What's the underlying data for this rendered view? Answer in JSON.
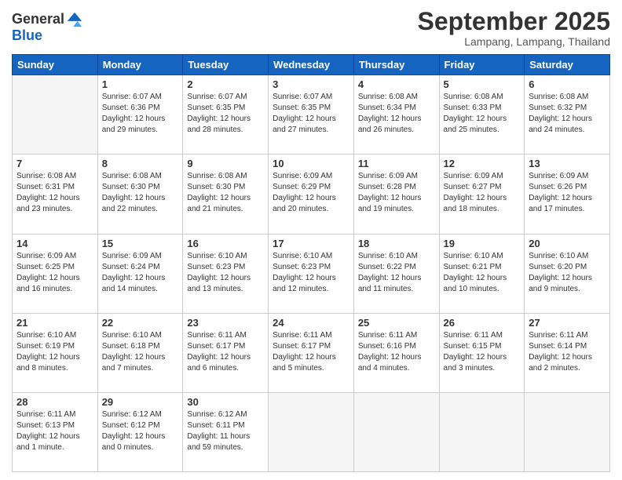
{
  "logo": {
    "general": "General",
    "blue": "Blue"
  },
  "header": {
    "month": "September 2025",
    "location": "Lampang, Lampang, Thailand"
  },
  "weekdays": [
    "Sunday",
    "Monday",
    "Tuesday",
    "Wednesday",
    "Thursday",
    "Friday",
    "Saturday"
  ],
  "weeks": [
    [
      {
        "day": "",
        "empty": true
      },
      {
        "day": "1",
        "sunrise": "6:07 AM",
        "sunset": "6:36 PM",
        "daylight": "12 hours and 29 minutes."
      },
      {
        "day": "2",
        "sunrise": "6:07 AM",
        "sunset": "6:35 PM",
        "daylight": "12 hours and 28 minutes."
      },
      {
        "day": "3",
        "sunrise": "6:07 AM",
        "sunset": "6:35 PM",
        "daylight": "12 hours and 27 minutes."
      },
      {
        "day": "4",
        "sunrise": "6:08 AM",
        "sunset": "6:34 PM",
        "daylight": "12 hours and 26 minutes."
      },
      {
        "day": "5",
        "sunrise": "6:08 AM",
        "sunset": "6:33 PM",
        "daylight": "12 hours and 25 minutes."
      },
      {
        "day": "6",
        "sunrise": "6:08 AM",
        "sunset": "6:32 PM",
        "daylight": "12 hours and 24 minutes."
      }
    ],
    [
      {
        "day": "7",
        "sunrise": "6:08 AM",
        "sunset": "6:31 PM",
        "daylight": "12 hours and 23 minutes."
      },
      {
        "day": "8",
        "sunrise": "6:08 AM",
        "sunset": "6:30 PM",
        "daylight": "12 hours and 22 minutes."
      },
      {
        "day": "9",
        "sunrise": "6:08 AM",
        "sunset": "6:30 PM",
        "daylight": "12 hours and 21 minutes."
      },
      {
        "day": "10",
        "sunrise": "6:09 AM",
        "sunset": "6:29 PM",
        "daylight": "12 hours and 20 minutes."
      },
      {
        "day": "11",
        "sunrise": "6:09 AM",
        "sunset": "6:28 PM",
        "daylight": "12 hours and 19 minutes."
      },
      {
        "day": "12",
        "sunrise": "6:09 AM",
        "sunset": "6:27 PM",
        "daylight": "12 hours and 18 minutes."
      },
      {
        "day": "13",
        "sunrise": "6:09 AM",
        "sunset": "6:26 PM",
        "daylight": "12 hours and 17 minutes."
      }
    ],
    [
      {
        "day": "14",
        "sunrise": "6:09 AM",
        "sunset": "6:25 PM",
        "daylight": "12 hours and 16 minutes."
      },
      {
        "day": "15",
        "sunrise": "6:09 AM",
        "sunset": "6:24 PM",
        "daylight": "12 hours and 14 minutes."
      },
      {
        "day": "16",
        "sunrise": "6:10 AM",
        "sunset": "6:23 PM",
        "daylight": "12 hours and 13 minutes."
      },
      {
        "day": "17",
        "sunrise": "6:10 AM",
        "sunset": "6:23 PM",
        "daylight": "12 hours and 12 minutes."
      },
      {
        "day": "18",
        "sunrise": "6:10 AM",
        "sunset": "6:22 PM",
        "daylight": "12 hours and 11 minutes."
      },
      {
        "day": "19",
        "sunrise": "6:10 AM",
        "sunset": "6:21 PM",
        "daylight": "12 hours and 10 minutes."
      },
      {
        "day": "20",
        "sunrise": "6:10 AM",
        "sunset": "6:20 PM",
        "daylight": "12 hours and 9 minutes."
      }
    ],
    [
      {
        "day": "21",
        "sunrise": "6:10 AM",
        "sunset": "6:19 PM",
        "daylight": "12 hours and 8 minutes."
      },
      {
        "day": "22",
        "sunrise": "6:10 AM",
        "sunset": "6:18 PM",
        "daylight": "12 hours and 7 minutes."
      },
      {
        "day": "23",
        "sunrise": "6:11 AM",
        "sunset": "6:17 PM",
        "daylight": "12 hours and 6 minutes."
      },
      {
        "day": "24",
        "sunrise": "6:11 AM",
        "sunset": "6:17 PM",
        "daylight": "12 hours and 5 minutes."
      },
      {
        "day": "25",
        "sunrise": "6:11 AM",
        "sunset": "6:16 PM",
        "daylight": "12 hours and 4 minutes."
      },
      {
        "day": "26",
        "sunrise": "6:11 AM",
        "sunset": "6:15 PM",
        "daylight": "12 hours and 3 minutes."
      },
      {
        "day": "27",
        "sunrise": "6:11 AM",
        "sunset": "6:14 PM",
        "daylight": "12 hours and 2 minutes."
      }
    ],
    [
      {
        "day": "28",
        "sunrise": "6:11 AM",
        "sunset": "6:13 PM",
        "daylight": "12 hours and 1 minute."
      },
      {
        "day": "29",
        "sunrise": "6:12 AM",
        "sunset": "6:12 PM",
        "daylight": "12 hours and 0 minutes."
      },
      {
        "day": "30",
        "sunrise": "6:12 AM",
        "sunset": "6:11 PM",
        "daylight": "11 hours and 59 minutes."
      },
      {
        "day": "",
        "empty": true
      },
      {
        "day": "",
        "empty": true
      },
      {
        "day": "",
        "empty": true
      },
      {
        "day": "",
        "empty": true
      }
    ]
  ]
}
